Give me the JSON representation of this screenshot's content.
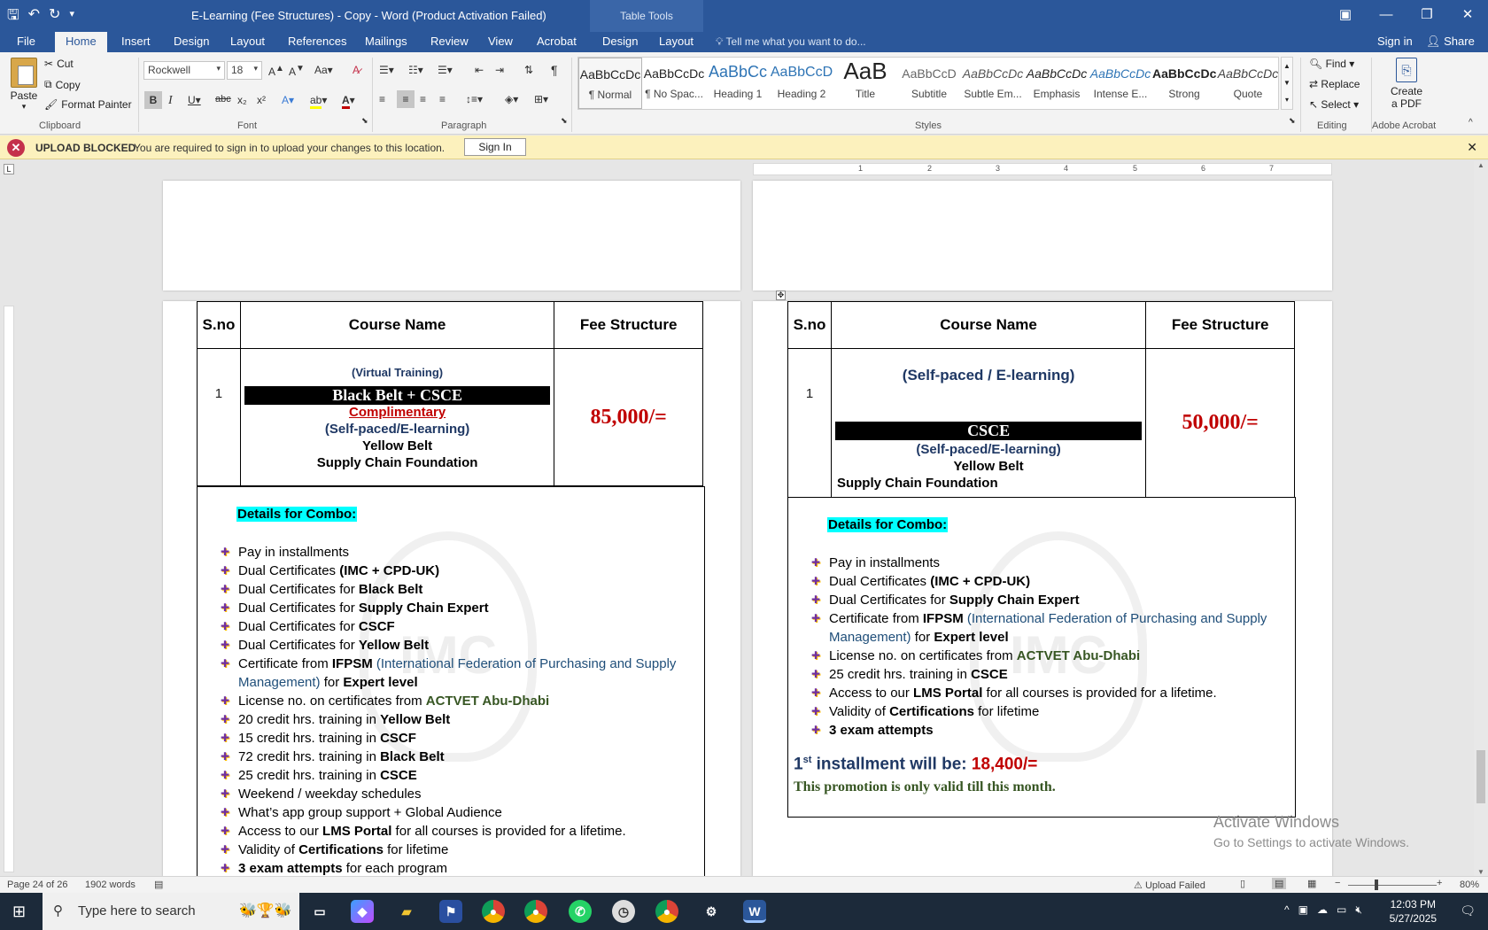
{
  "window": {
    "title": "E-Learning (Fee Structures) - Copy - Word (Product Activation Failed)",
    "table_tools": "Table Tools"
  },
  "tabs": [
    "File",
    "Home",
    "Insert",
    "Design",
    "Layout",
    "References",
    "Mailings",
    "Review",
    "View",
    "Acrobat",
    "Design",
    "Layout"
  ],
  "tell_me": "Tell me what you want to do...",
  "sign_in": "Sign in",
  "share": "Share",
  "clipboard": {
    "paste": "Paste",
    "cut": "Cut",
    "copy": "Copy",
    "format_painter": "Format Painter",
    "label": "Clipboard"
  },
  "font": {
    "name": "Rockwell",
    "size": "18",
    "label": "Font"
  },
  "paragraph_label": "Paragraph",
  "styles": {
    "label": "Styles",
    "items": [
      {
        "preview": "AaBbCcDc",
        "name": "¶ Normal"
      },
      {
        "preview": "AaBbCcDc",
        "name": "¶ No Spac..."
      },
      {
        "preview": "AaBbCc",
        "name": "Heading 1"
      },
      {
        "preview": "AaBbCcD",
        "name": "Heading 2"
      },
      {
        "preview": "AaB",
        "name": "Title"
      },
      {
        "preview": "AaBbCcD",
        "name": "Subtitle"
      },
      {
        "preview": "AaBbCcDc",
        "name": "Subtle Em..."
      },
      {
        "preview": "AaBbCcDc",
        "name": "Emphasis"
      },
      {
        "preview": "AaBbCcDc",
        "name": "Intense E..."
      },
      {
        "preview": "AaBbCcDc",
        "name": "Strong"
      },
      {
        "preview": "AaBbCcDc",
        "name": "Quote"
      }
    ]
  },
  "editing": {
    "find": "Find",
    "replace": "Replace",
    "select": "Select",
    "label": "Editing"
  },
  "acrobat": {
    "create": "Create",
    "pdf": "a PDF",
    "label": "Adobe Acrobat"
  },
  "message": {
    "title": "UPLOAD BLOCKED",
    "text": "You are required to sign in to upload your changes to this location.",
    "button": "Sign In"
  },
  "ruler_numbers": [
    "1",
    "1",
    "2",
    "3",
    "4",
    "5",
    "6",
    "7"
  ],
  "left_page": {
    "headers": [
      "S.no",
      "Course Name",
      "Fee Structure"
    ],
    "sno": "1",
    "virtual": "(Virtual Training)",
    "course": "Black Belt + CSCE",
    "complimentary": "Complimentary",
    "selfpaced": "(Self-paced/E-learning)",
    "yellow": "Yellow Belt",
    "supply": "Supply Chain Foundation",
    "fee": "85,000/=",
    "combo_title": "Details for Combo:",
    "bullets": [
      [
        "Pay in installments"
      ],
      [
        "Dual Certificates ",
        "(IMC + CPD-UK)"
      ],
      [
        "Dual Certificates for ",
        "Black Belt"
      ],
      [
        "Dual Certificates for ",
        "Supply Chain Expert"
      ],
      [
        "Dual Certificates for ",
        "CSCF"
      ],
      [
        "Dual Certificates for ",
        "Yellow Belt"
      ],
      [
        "20 credit hrs. training in ",
        "Yellow Belt"
      ],
      [
        "15 credit hrs. training in ",
        "CSCF"
      ],
      [
        "72 credit hrs. training in ",
        "Black Belt"
      ],
      [
        "25 credit hrs. training in ",
        "CSCE"
      ],
      [
        "Weekend / weekday schedules"
      ],
      [
        "What’s app group support + Global Audience"
      ]
    ],
    "ifpsm": {
      "pre": "Certificate from ",
      "org": "IFPSM",
      "full": " (International Federation of Purchasing and Supply Management)",
      "mid": " for ",
      "level": "Expert level"
    },
    "license": {
      "pre": "License no. on certificates from ",
      "org": "ACTVET Abu-Dhabi"
    },
    "lms": {
      "pre": " Access to our ",
      "bold": "LMS Portal",
      "post": " for all courses is provided for a lifetime."
    },
    "validity": {
      "pre": "Validity of ",
      "bold": "Certifications",
      "post": " for lifetime"
    },
    "exam": {
      "bold": "3 exam attempts",
      "post": " for each program"
    }
  },
  "right_page": {
    "headers": [
      "S.no",
      "Course Name",
      "Fee Structure"
    ],
    "sno": "1",
    "selfpaced_top": "(Self-paced / E-learning)",
    "course": "CSCE",
    "selfpaced": "(Self-paced/E-learning)",
    "yellow": "Yellow Belt",
    "supply": "Supply Chain Foundation",
    "fee": "50,000/=",
    "combo_title": "Details for Combo:",
    "bullets": [
      [
        "Pay in installments"
      ],
      [
        "Dual Certificates ",
        "(IMC + CPD-UK)"
      ],
      [
        "Dual Certificates for ",
        "Supply Chain Expert"
      ]
    ],
    "ifpsm": {
      "pre": "Certificate from ",
      "org": "IFPSM",
      "full": " (International Federation of Purchasing and Supply Management)",
      "mid": " for ",
      "level": "Expert level"
    },
    "license": {
      "pre": "License no. on certificates from ",
      "org": "ACTVET Abu-Dhabi"
    },
    "credit": {
      "pre": "25 credit hrs. training in ",
      "bold": "CSCE"
    },
    "lms": {
      "pre": "Access to our ",
      "bold": "LMS Portal",
      "post": " for all courses is provided for a lifetime."
    },
    "validity": {
      "pre": "Validity of ",
      "bold": "Certifications",
      "post": " for lifetime"
    },
    "exam": {
      "bold": "3 exam attempts"
    },
    "installment": {
      "pre": "1",
      "sup": "st",
      "mid": " installment will be: ",
      "amount": "18,400/="
    },
    "promo": "This promotion is only valid till this month."
  },
  "activate": {
    "line1": "Activate Windows",
    "line2": "Go to Settings to activate Windows."
  },
  "status": {
    "page": "Page 24 of 26",
    "words": "1902 words",
    "upload": "Upload Failed",
    "zoom": "80%"
  },
  "taskbar": {
    "search": "Type here to search",
    "time": "12:03 PM",
    "date": "5/27/2025"
  },
  "colors": {
    "word_blue": "#2b579a",
    "fee_red": "#c00000",
    "navy": "#1f3864",
    "cyan": "#00ffff"
  }
}
